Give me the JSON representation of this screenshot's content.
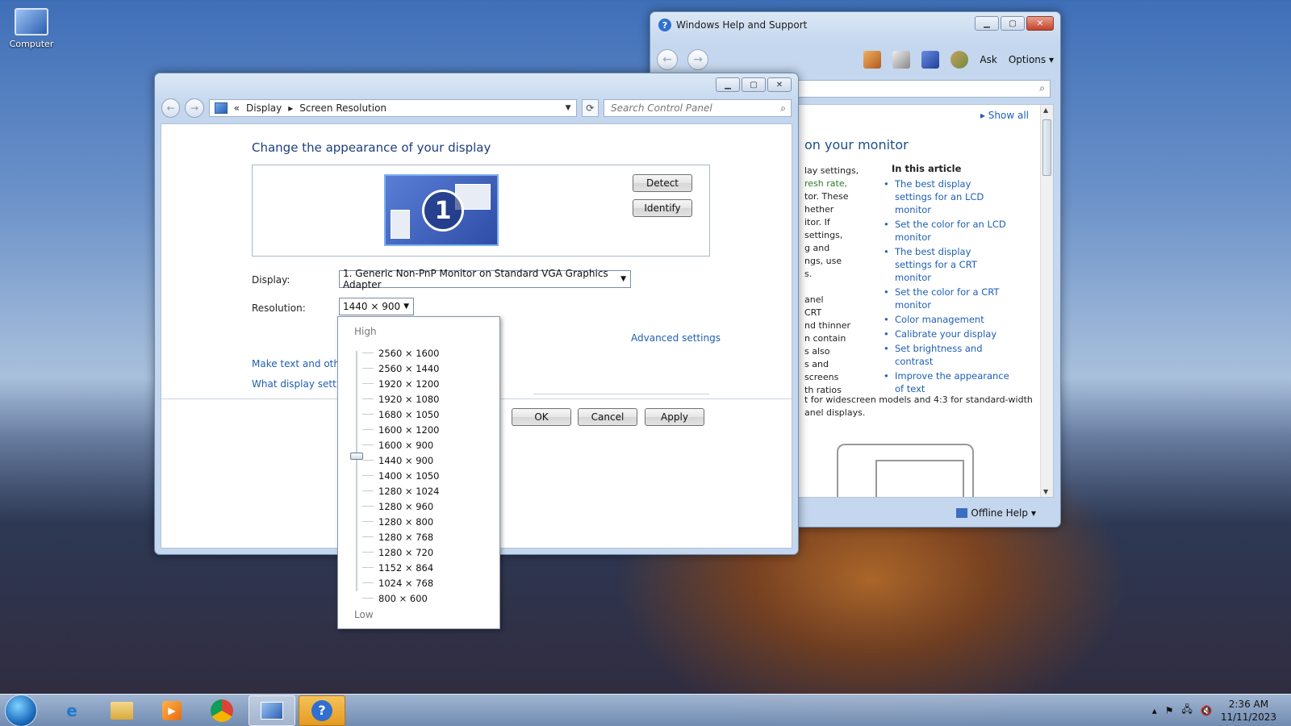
{
  "desktop": {
    "computer_label": "Computer"
  },
  "help_window": {
    "title": "Windows Help and Support",
    "toolbar": {
      "ask": "Ask",
      "options": "Options"
    },
    "show_all": "Show all",
    "heading": "on your monitor",
    "body_lines": [
      "lay settings,",
      "resh rate,",
      "tor. These",
      "hether",
      "itor. If",
      " settings,",
      "g and",
      "ngs, use",
      "s.",
      "",
      "anel",
      "CRT",
      "nd thinner",
      "n contain",
      "s also",
      "s and",
      "screens",
      "th ratios"
    ],
    "tail_text": "t for widescreen models and 4:3 for standard-width anel displays.",
    "article_heading": "In this article",
    "article_links": [
      "The best display settings for an LCD monitor",
      "Set the color for an LCD monitor",
      "The best display settings for a CRT monitor",
      "Set the color for a CRT monitor",
      "Color management",
      "Calibrate your display",
      "Set brightness and contrast",
      "Improve the appearance of text"
    ],
    "status": "Offline Help"
  },
  "control_panel": {
    "breadcrumb": {
      "sep": "«",
      "item1": "Display",
      "arrow": "▸",
      "item2": "Screen Resolution"
    },
    "search_placeholder": "Search Control Panel",
    "page_title": "Change the appearance of your display",
    "monitor_number": "1",
    "detect": "Detect",
    "identify": "Identify",
    "display_label": "Display:",
    "display_value": "1. Generic Non-PnP Monitor on Standard VGA Graphics Adapter",
    "resolution_label": "Resolution:",
    "resolution_value": "1440 × 900",
    "advanced_settings": "Advanced settings",
    "link_text_size": "Make text and other",
    "link_what_display": "What display setting",
    "ok": "OK",
    "cancel": "Cancel",
    "apply": "Apply"
  },
  "resolution_dropdown": {
    "high": "High",
    "low": "Low",
    "options": [
      "2560 × 1600",
      "2560 × 1440",
      "1920 × 1200",
      "1920 × 1080",
      "1680 × 1050",
      "1600 × 1200",
      "1600 × 900",
      "1440 × 900",
      "1400 × 1050",
      "1280 × 1024",
      "1280 × 960",
      "1280 × 800",
      "1280 × 768",
      "1280 × 720",
      "1152 × 864",
      "1024 × 768",
      "800 × 600"
    ],
    "selected": "1440 × 900"
  },
  "taskbar": {
    "time": "2:36 AM",
    "date": "11/11/2023",
    "items": [
      "internet-explorer-icon",
      "file-explorer-icon",
      "media-player-icon",
      "chrome-icon",
      "control-panel-icon",
      "help-icon"
    ]
  }
}
